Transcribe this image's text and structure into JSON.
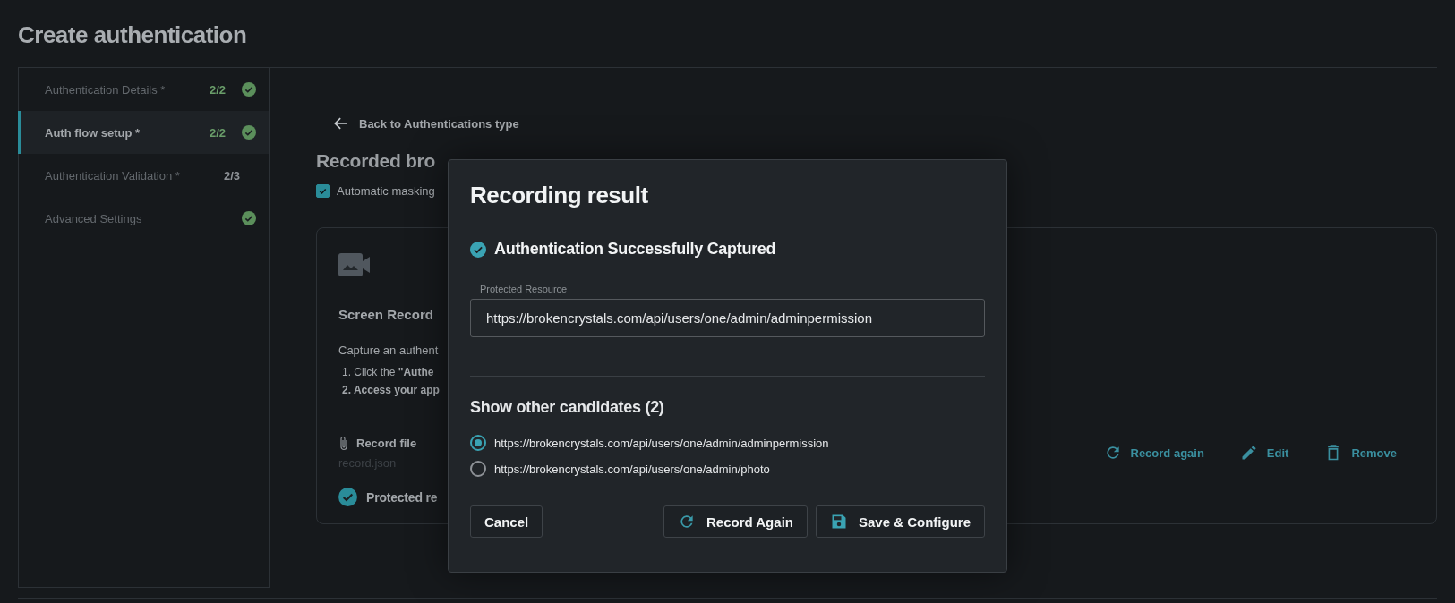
{
  "page": {
    "title": "Create authentication"
  },
  "steps": [
    {
      "label": "Authentication Details *",
      "count": "2/2",
      "complete": true,
      "selected": false
    },
    {
      "label": "Auth flow setup *",
      "count": "2/2",
      "complete": true,
      "selected": true
    },
    {
      "label": "Authentication Validation *",
      "count": "2/3",
      "complete": false,
      "selected": false
    },
    {
      "label": "Advanced Settings",
      "complete": true,
      "selected": false
    }
  ],
  "back_link": "Back to Authentications type",
  "heading": "Recorded bro",
  "masking": {
    "label": "Automatic masking",
    "checked": true
  },
  "card": {
    "title": "Screen Record",
    "description": "Capture an authent",
    "instructions": [
      {
        "number": "1.",
        "text": "Click the **\"Authe**",
        "bold": false
      },
      {
        "number": "2.",
        "text": "Access your app",
        "bold": true
      }
    ],
    "record_file": {
      "label": "Record file",
      "file": "record.json"
    },
    "status": "Protected re",
    "actions": [
      {
        "kind": "refresh",
        "label": "Record again"
      },
      {
        "kind": "edit",
        "label": "Edit"
      },
      {
        "kind": "delete",
        "label": "Remove"
      }
    ]
  },
  "dialog": {
    "title": "Recording result",
    "status": "Authentication Successfully Captured",
    "field": {
      "label": "Protected Resource",
      "value": "https://brokencrystals.com/api/users/one/admin/adminpermission"
    },
    "candidates_title": "Show other candidates (2)",
    "candidates": [
      {
        "label": "https://brokencrystals.com/api/users/one/admin/adminpermission",
        "selected": true
      },
      {
        "label": "https://brokencrystals.com/api/users/one/admin/photo",
        "selected": false
      }
    ],
    "buttons": [
      {
        "kind": "cancel",
        "label": "Cancel"
      },
      {
        "kind": "refresh",
        "label": "Record Again"
      },
      {
        "kind": "save",
        "label": "Save & Configure"
      }
    ]
  }
}
